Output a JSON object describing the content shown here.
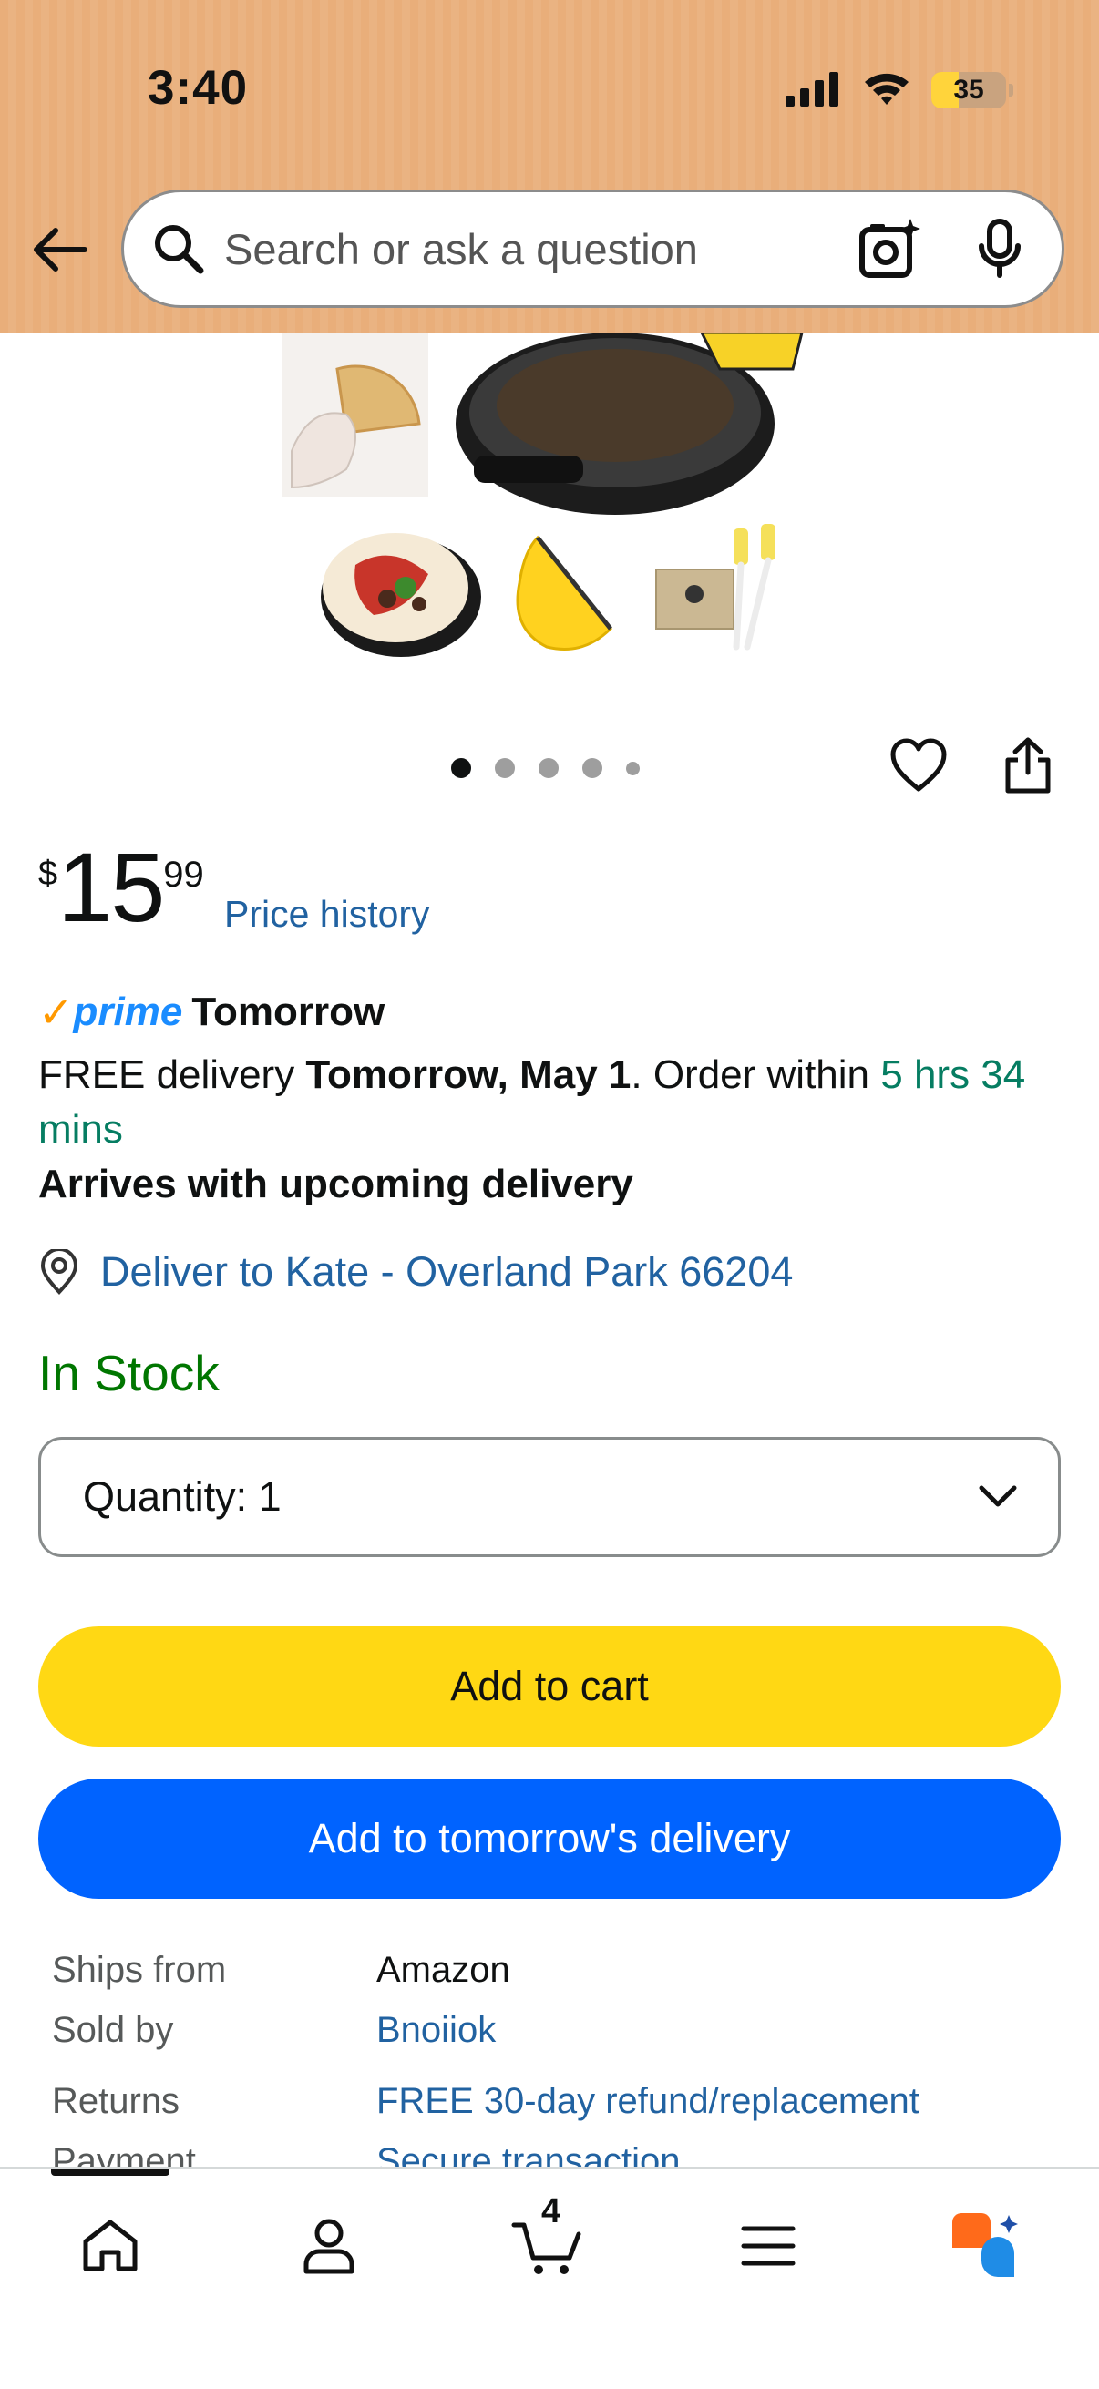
{
  "status_bar": {
    "time": "3:40",
    "battery": "35",
    "icons": [
      "cellular-signal-icon",
      "wifi-icon",
      "battery-icon"
    ]
  },
  "header": {
    "search_placeholder": "Search or ask a question",
    "icons": [
      "back-arrow-icon",
      "search-icon",
      "camera-sparkle-icon",
      "microphone-icon"
    ]
  },
  "gallery": {
    "image_count": 5,
    "active_index": 0
  },
  "product": {
    "price_currency": "$",
    "price_whole": "15",
    "price_fraction": "99",
    "price_history_label": "Price history"
  },
  "delivery": {
    "prime_label": "prime",
    "prime_speed": "Tomorrow",
    "free_delivery_prefix": "FREE delivery ",
    "delivery_date": "Tomorrow, May 1",
    "order_within_prefix": ". Order within ",
    "countdown": "5 hrs 34 mins",
    "arrives_note": "Arrives with upcoming delivery",
    "deliver_to": "Deliver to Kate - Overland Park 66204"
  },
  "stock": {
    "status": "In Stock",
    "quantity_label": "Quantity: 1"
  },
  "actions": {
    "add_to_cart": "Add to cart",
    "add_to_tomorrow": "Add to tomorrow's delivery"
  },
  "details": [
    {
      "key": "Ships from",
      "value": "Amazon",
      "link": false
    },
    {
      "key": "Sold by",
      "value": "Bnoiiok",
      "link": true
    },
    {
      "key": "Returns",
      "value": "FREE 30-day refund/replacement",
      "link": true
    },
    {
      "key": "Payment",
      "value": "Secure transaction",
      "link": true
    }
  ],
  "bottom_nav": {
    "cart_count": "4",
    "items": [
      "home-icon",
      "account-icon",
      "cart-icon",
      "menu-icon",
      "rufus-ai-icon"
    ]
  },
  "colors": {
    "header_bg": "#e9ae7a",
    "add_to_cart": "#ffd814",
    "add_to_tomorrow": "#0063ff",
    "link": "#2162a1",
    "in_stock": "#007600",
    "countdown": "#067d62",
    "prime_blue": "#1a8cff",
    "prime_check": "#ff9900"
  }
}
